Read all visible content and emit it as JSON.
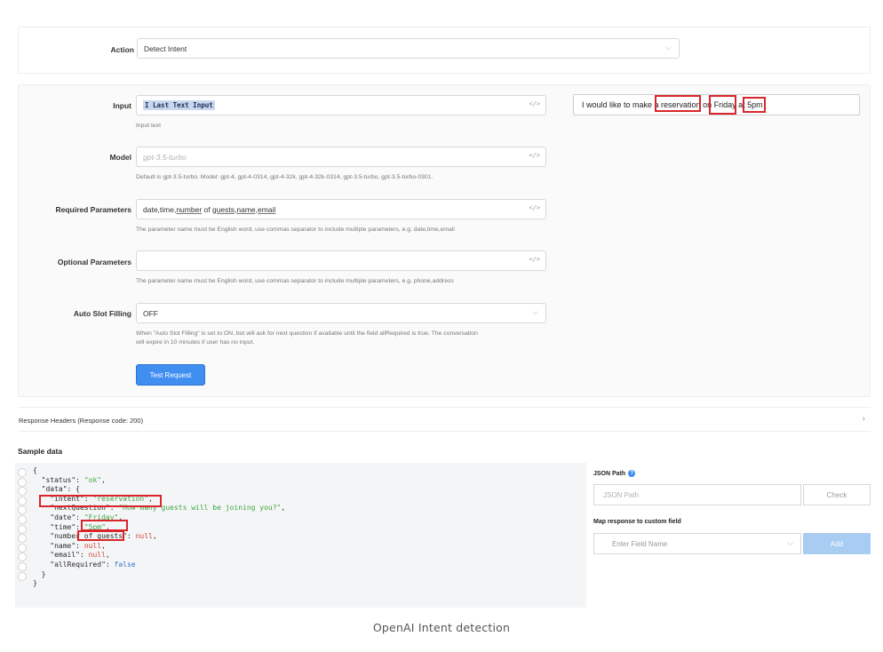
{
  "action": {
    "label": "Action",
    "value": "Detect Intent"
  },
  "input": {
    "label": "Input",
    "token_icon": "I",
    "token_text": "Last Text Input",
    "hint": "Input text"
  },
  "model": {
    "label": "Model",
    "placeholder": "gpt-3.5-turbo",
    "hint": "Default is gpt-3.5-turbo. Model: gpt-4, gpt-4-0314, gpt-4-32k, gpt-4-32k-0314, gpt-3.5-turbo, gpt-3.5-turbo-0301."
  },
  "required_params": {
    "label": "Required Parameters",
    "value_a": "date,time,",
    "value_b": "number",
    "value_c": " of ",
    "value_d": "guests,name,email",
    "hint": "The parameter name must be English word, use commas separator to include multiple parameters, e.g. date,time,email"
  },
  "optional_params": {
    "label": "Optional Parameters",
    "value": "",
    "hint": "The parameter name must be English word, use commas separator to include multiple parameters, e.g. phone,address"
  },
  "auto_slot": {
    "label": "Auto Slot Filling",
    "value": "OFF",
    "hint_line1": "When \"Auto Slot Filling\" is set to ON, bot will ask for next question if available until the field allRequired is true. The conversation",
    "hint_line2": "will expire in 10 minutes if user has no input."
  },
  "test_button": "Test Request",
  "preview_text": "I would like to make a reservation on Friday at 5pm",
  "response_header": "Response Headers (Response code: 200)",
  "sample_title": "Sample data",
  "json_sample": {
    "open": "{",
    "status_key": "\"status\"",
    "status_val": "\"ok\"",
    "data_key": "\"data\"",
    "intent_key": "\"intent\"",
    "intent_val": "\"reservation\"",
    "nextq_key": "\"nextQuestion\"",
    "nextq_val": "\"How many guests will be joining you?\"",
    "date_key": "\"date\"",
    "date_val": "\"Friday\"",
    "time_key": "\"time\"",
    "time_val": "\"5pm\"",
    "guests_key": "\"number_of_guests\"",
    "name_key": "\"name\"",
    "email_key": "\"email\"",
    "allreq_key": "\"allRequired\"",
    "null_val": "null",
    "false_val": "false",
    "close_inner": "}",
    "close": "}"
  },
  "json_path": {
    "label": "JSON Path",
    "placeholder": "JSON Path",
    "check_label": "Check"
  },
  "map_response": {
    "label": "Map response to custom field",
    "placeholder": "Enter Field Name",
    "add_label": "Add"
  },
  "caption": "OpenAI Intent detection",
  "colors": {
    "primary": "#3f8ef0",
    "highlight_border": "#d9262b",
    "json_string": "#3fa53f",
    "json_null": "#d8463d",
    "json_bool": "#2c77c8"
  }
}
